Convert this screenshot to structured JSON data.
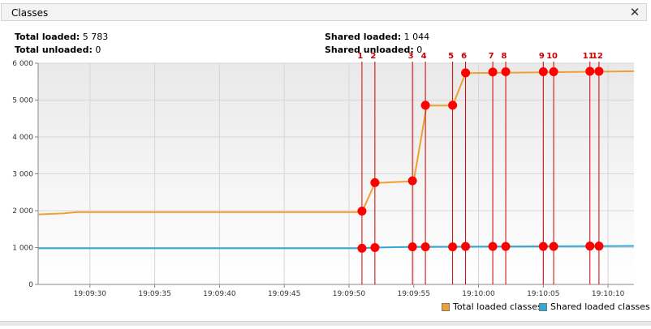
{
  "window": {
    "title": "Classes",
    "close_glyph": "✕"
  },
  "stats": {
    "total_loaded_label": "Total loaded:",
    "total_loaded_value": "5 783",
    "total_unloaded_label": "Total unloaded:",
    "total_unloaded_value": "0",
    "shared_loaded_label": "Shared loaded:",
    "shared_loaded_value": "1 044",
    "shared_unloaded_label": "Shared unloaded:",
    "shared_unloaded_value": "0"
  },
  "legend": {
    "total_label": "Total loaded classes",
    "shared_label": "Shared loaded classes"
  },
  "colors": {
    "total": "#f0a030",
    "shared": "#30a8d8",
    "marker": "#ff0000",
    "marker_line": "#cc0000"
  },
  "chart_data": {
    "type": "line",
    "x_domain": [
      "19:09:26",
      "19:10:12"
    ],
    "ylim": [
      0,
      6000
    ],
    "y_ticks": [
      0,
      1000,
      2000,
      3000,
      4000,
      5000,
      6000
    ],
    "y_tick_labels": [
      "0",
      "1 000",
      "2 000",
      "3 000",
      "4 000",
      "5 000",
      "6 000"
    ],
    "x_ticks": [
      "19:09:30",
      "19:09:35",
      "19:09:40",
      "19:09:45",
      "19:09:50",
      "19:09:55",
      "19:10:00",
      "19:10:05",
      "19:10:10"
    ],
    "grid": true,
    "legend_position": "bottom-right",
    "series": [
      {
        "name": "Total loaded classes",
        "color": "#f0a030",
        "points": [
          [
            "19:09:26",
            1900
          ],
          [
            "19:09:28",
            1930
          ],
          [
            "19:09:29",
            1960
          ],
          [
            "19:09:51",
            1960
          ],
          [
            "19:09:52",
            2750
          ],
          [
            "19:09:55",
            2800
          ],
          [
            "19:09:56",
            4850
          ],
          [
            "19:09:58",
            4850
          ],
          [
            "19:09:59",
            5730
          ],
          [
            "19:10:12",
            5783
          ]
        ]
      },
      {
        "name": "Shared loaded classes",
        "color": "#30a8d8",
        "points": [
          [
            "19:09:26",
            980
          ],
          [
            "19:09:51",
            980
          ],
          [
            "19:09:52",
            1000
          ],
          [
            "19:09:55",
            1020
          ],
          [
            "19:10:12",
            1044
          ]
        ]
      }
    ],
    "annotations": [
      {
        "label": "1",
        "time": "19:09:51.0",
        "total": 1990,
        "shared": 980
      },
      {
        "label": "2",
        "time": "19:09:52.0",
        "total": 2760,
        "shared": 1000
      },
      {
        "label": "3",
        "time": "19:09:54.9",
        "total": 2810,
        "shared": 1020
      },
      {
        "label": "4",
        "time": "19:09:55.9",
        "total": 4860,
        "shared": 1020
      },
      {
        "label": "5",
        "time": "19:09:58.0",
        "total": 4860,
        "shared": 1020
      },
      {
        "label": "6",
        "time": "19:09:59.0",
        "total": 5740,
        "shared": 1030
      },
      {
        "label": "7",
        "time": "19:10:01.1",
        "total": 5760,
        "shared": 1030
      },
      {
        "label": "8",
        "time": "19:10:02.1",
        "total": 5770,
        "shared": 1030
      },
      {
        "label": "9",
        "time": "19:10:05.0",
        "total": 5770,
        "shared": 1030
      },
      {
        "label": "10",
        "time": "19:10:05.8",
        "total": 5770,
        "shared": 1030
      },
      {
        "label": "11",
        "time": "19:10:08.6",
        "total": 5780,
        "shared": 1040
      },
      {
        "label": "12",
        "time": "19:10:09.3",
        "total": 5780,
        "shared": 1040
      }
    ]
  }
}
